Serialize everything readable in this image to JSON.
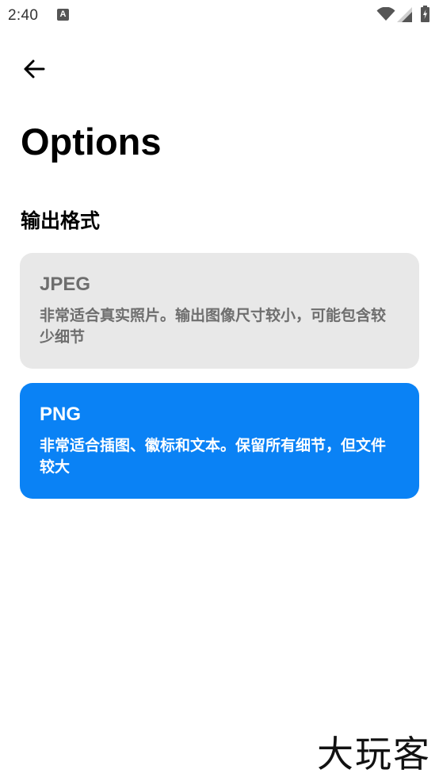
{
  "status_bar": {
    "time": "2:40",
    "notification_glyph": "A",
    "icons": [
      "wifi-icon",
      "signal-icon",
      "battery-icon"
    ]
  },
  "header": {
    "back_icon": "arrow-left-icon",
    "title": "Options"
  },
  "section": {
    "title": "输出格式"
  },
  "options": [
    {
      "title": "JPEG",
      "description": "非常适合真实照片。输出图像尺寸较小，可能包含较少细节",
      "selected": false,
      "background": "#e8e8e8",
      "text_color": "#6e6e6e"
    },
    {
      "title": "PNG",
      "description": "非常适合插图、徽标和文本。保留所有细节，但文件较大",
      "selected": true,
      "background": "#0a82f5",
      "text_color": "#ffffff"
    }
  ],
  "watermark": {
    "text": "大玩客"
  }
}
